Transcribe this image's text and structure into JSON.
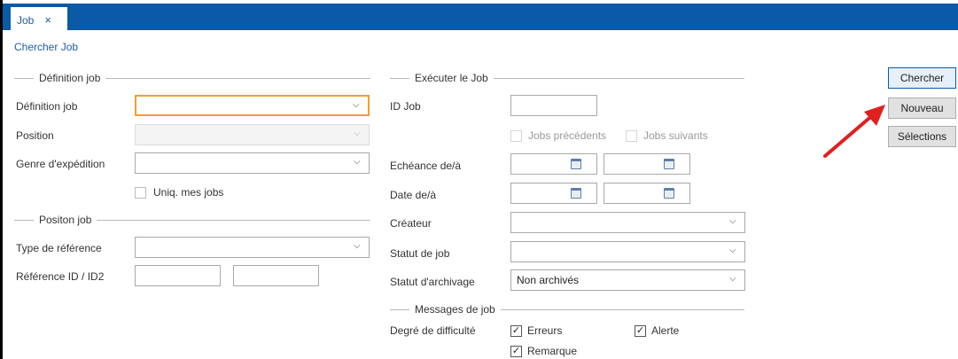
{
  "tab": {
    "label": "Job",
    "close": "×"
  },
  "subtitle": "Chercher Job",
  "definition_section": "Définition job",
  "definition_fields": {
    "definition_job_label": "Définition job",
    "position_label": "Position",
    "genre_label": "Genre d'expédition",
    "uniq_label": "Uniq. mes jobs"
  },
  "position_section": "Positon job",
  "position_fields": {
    "type_ref_label": "Type de référence",
    "ref_id_label": "Référence ID / ID2"
  },
  "executer_section": "Exécuter le Job",
  "executer_fields": {
    "id_job_label": "ID Job",
    "jobs_precedents": "Jobs précédents",
    "jobs_suivants": "Jobs suivants",
    "echeance_label": "Echéance de/à",
    "date_label": "Date de/à",
    "createur_label": "Créateur",
    "statut_job_label": "Statut de job",
    "statut_archivage_label": "Statut d'archivage",
    "statut_archivage_value": "Non archivés"
  },
  "messages_section": "Messages de job",
  "messages": {
    "degre_label": "Degré de difficulté",
    "erreurs": "Erreurs",
    "alerte": "Alerte",
    "remarque": "Remarque"
  },
  "buttons": {
    "chercher": "Chercher",
    "nouveau": "Nouveau",
    "selections": "Sélections"
  },
  "annotation": {
    "arrow_color": "#e02020"
  },
  "colors": {
    "accent": "#0a5aa8",
    "focus": "#f0a030"
  }
}
